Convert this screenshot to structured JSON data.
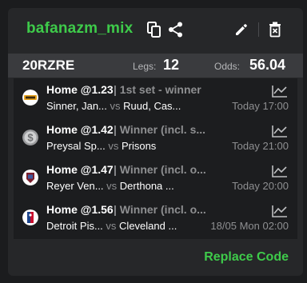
{
  "header": {
    "title": "bafanazm_mix",
    "icons": [
      "copy-icon",
      "share-icon",
      "pencil-icon",
      "trash-icon"
    ]
  },
  "summary": {
    "code": "20RZRE",
    "legs_label": "Legs:",
    "legs_value": "12",
    "odds_label": "Odds:",
    "odds_value": "56.04"
  },
  "legs": [
    {
      "pick": "Home @1.23",
      "market": "| 1st set - winner",
      "home": "Sinner, Jan...",
      "vs": "vs",
      "away": "Ruud, Cas...",
      "time": "Today 17:00",
      "icon": "tennis-logo-icon"
    },
    {
      "pick": "Home @1.42",
      "market": "| Winner (incl. s...",
      "home": "Preysal Sp...",
      "vs": "vs",
      "away": "Prisons",
      "time": "Today 21:00",
      "icon": "football-logo-icon"
    },
    {
      "pick": "Home @1.47",
      "market": "| Winner (incl. o...",
      "home": "Reyer Ven...",
      "vs": "vs",
      "away": "Derthona ...",
      "time": "Today 20:00",
      "icon": "basketball-team-logo-icon"
    },
    {
      "pick": "Home @1.56",
      "market": "| Winner (incl. o...",
      "home": "Detroit Pis...",
      "vs": "vs",
      "away": "Cleveland ...",
      "time": "18/05 Mon 02:00",
      "icon": "nba-logo-icon"
    }
  ],
  "footer": {
    "replace_label": "Replace Code"
  },
  "colors": {
    "accent": "#3ecb4a",
    "card": "#262729",
    "summary": "#3a3b3e",
    "list": "#1c1d1f",
    "muted": "#8e8f91"
  }
}
